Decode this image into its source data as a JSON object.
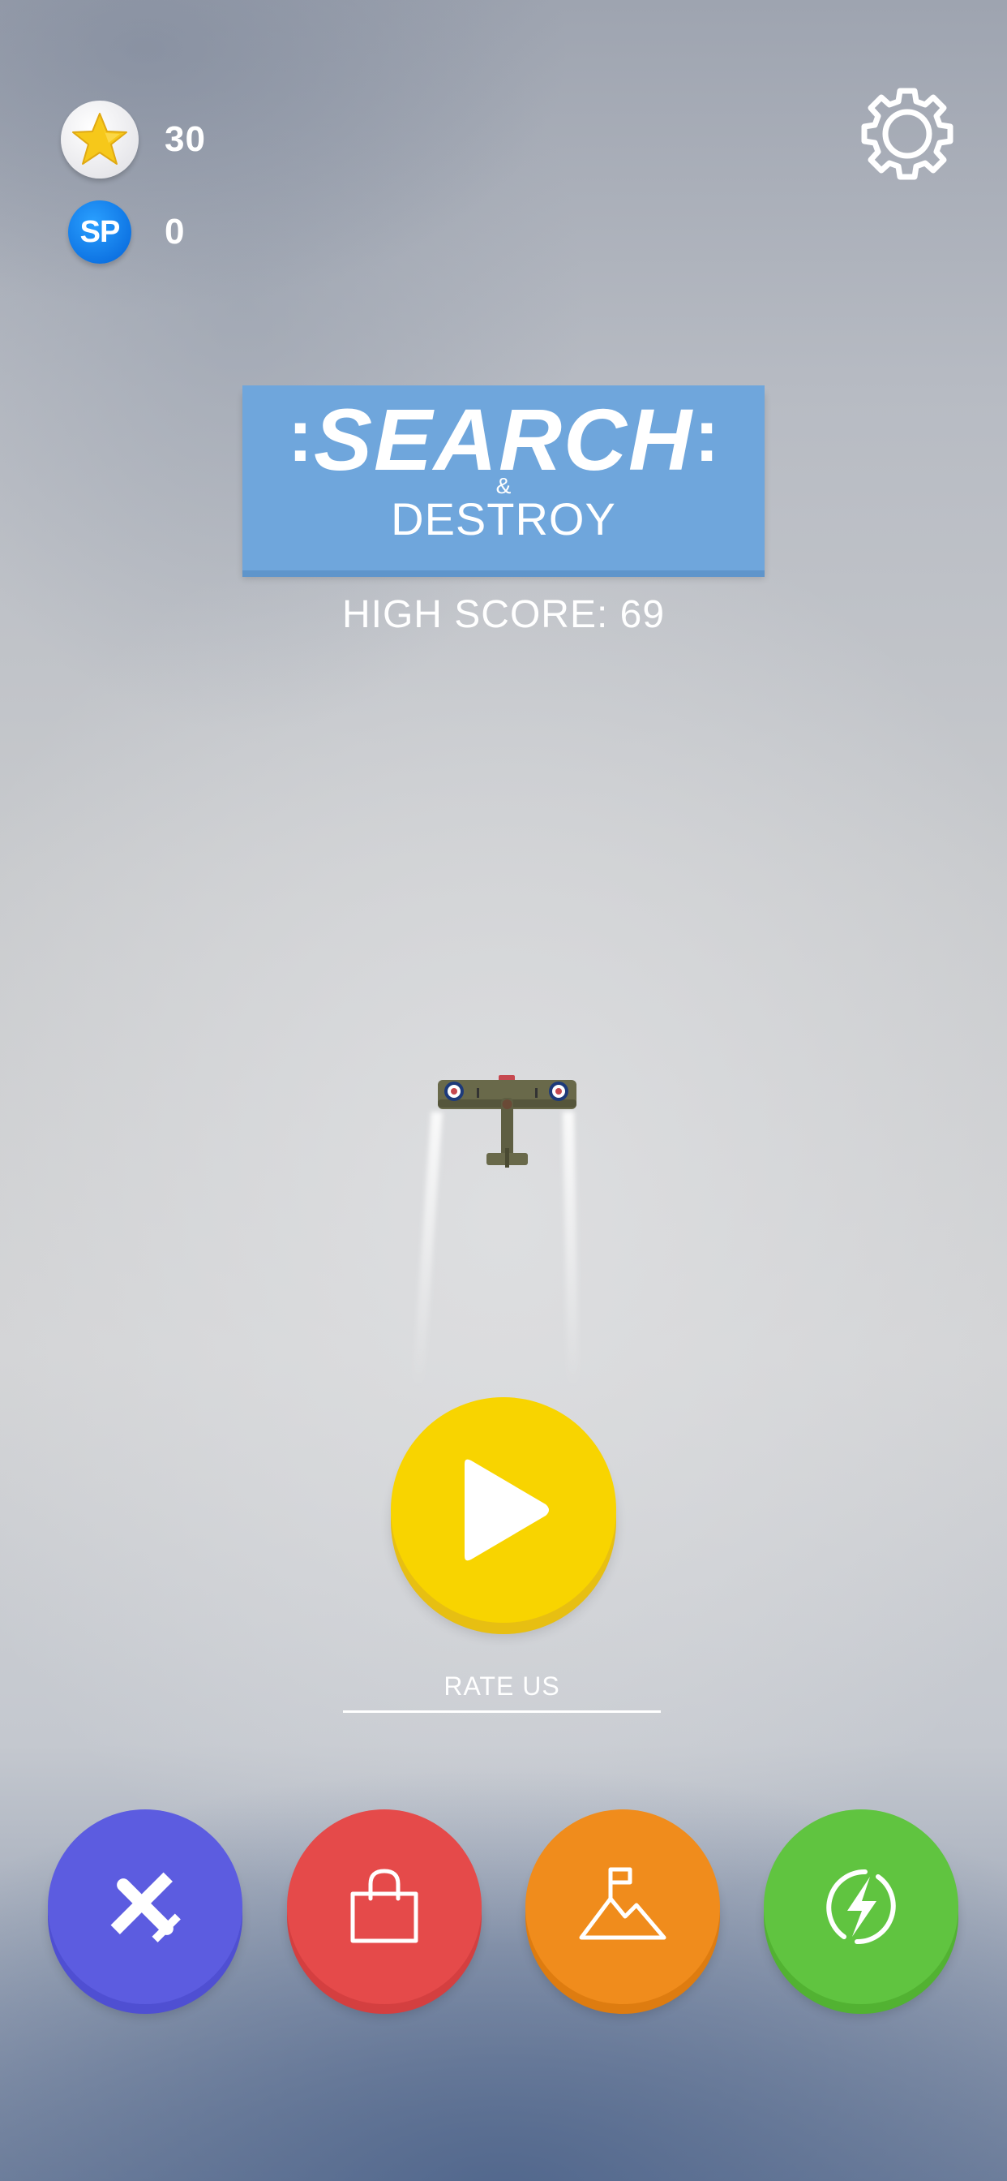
{
  "hud": {
    "stars": "30",
    "sp_label": "SP",
    "sp_points": "0"
  },
  "logo": {
    "title": "SEARCH",
    "ampersand": "&",
    "subtitle": "DESTROY",
    "left_decoration": ":",
    "right_decoration": ":"
  },
  "high_score": "HIGH SCORE: 69",
  "rate_us": "RATE US",
  "icons": {
    "star": "star-icon",
    "settings": "gear-icon",
    "play": "play-icon",
    "hangar": "airplane-icon",
    "shop": "shopping-bag-icon",
    "missions": "mountain-flag-icon",
    "power": "lightning-icon"
  },
  "colors": {
    "logo_panel": "#6fa6dc",
    "play_button": "#f8d400",
    "hangar_button": "#5c5ce0",
    "shop_button": "#e54a4a",
    "missions_button": "#f08c1c",
    "power_button": "#60c440",
    "sp_badge": "#0b6fe0"
  }
}
